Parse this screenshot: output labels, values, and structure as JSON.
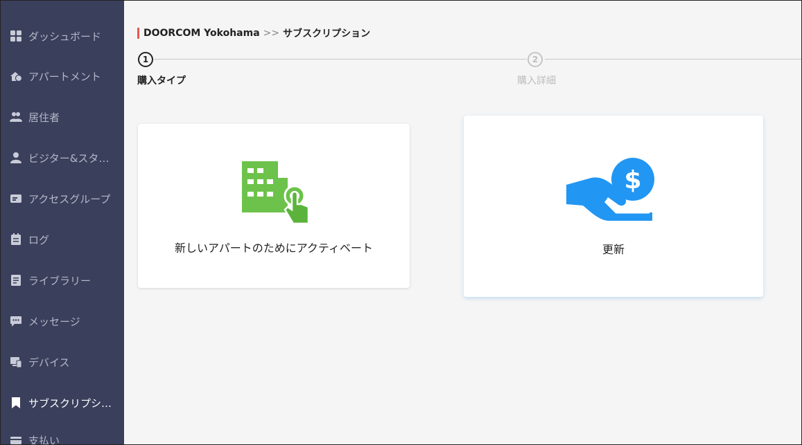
{
  "sidebar": {
    "items": [
      {
        "label": "ダッシュボード",
        "icon": "dashboard-icon"
      },
      {
        "label": "アパートメント",
        "icon": "apartment-icon"
      },
      {
        "label": "居住者",
        "icon": "residents-icon"
      },
      {
        "label": "ビジター&スタ…",
        "icon": "visitor-icon"
      },
      {
        "label": "アクセスグループ",
        "icon": "access-group-icon"
      },
      {
        "label": "ログ",
        "icon": "log-icon"
      },
      {
        "label": "ライブラリー",
        "icon": "library-icon"
      },
      {
        "label": "メッセージ",
        "icon": "message-icon"
      },
      {
        "label": "デバイス",
        "icon": "device-icon"
      },
      {
        "label": "サブスクリプシ…",
        "icon": "bookmark-icon"
      },
      {
        "label": "支払い",
        "icon": "payment-icon"
      }
    ]
  },
  "breadcrumb": {
    "site": "DOORCOM Yokohama",
    "separator": ">>",
    "page": "サブスクリプション"
  },
  "stepper": {
    "steps": [
      {
        "number": "1",
        "label": "購入タイプ"
      },
      {
        "number": "2",
        "label": "購入詳細"
      }
    ]
  },
  "cards": {
    "activate": {
      "label": "新しいアパートのためにアクティベート",
      "icon": "building-touch-icon"
    },
    "renew": {
      "label": "更新",
      "icon": "hand-dollar-icon"
    }
  },
  "colors": {
    "sidebar_bg": "#3a3f5c",
    "accent_red": "#e8584f",
    "green": "#6cc24a",
    "blue": "#2196f3"
  }
}
